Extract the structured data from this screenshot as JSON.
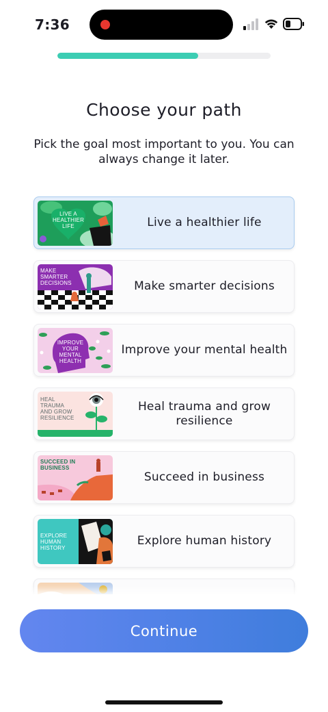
{
  "status_bar": {
    "time": "7:36",
    "icons": [
      "recording-dot-icon",
      "signal-icon",
      "wifi-icon",
      "battery-icon"
    ]
  },
  "progress": {
    "fraction": 0.66,
    "color": "#3ccdb3"
  },
  "header": {
    "title": "Choose your path",
    "subtitle": "Pick the goal most important to you. You can always change it later."
  },
  "options": [
    {
      "label": "Live a healthier life",
      "thumb_text": [
        "LIVE A",
        "HEALTHIER",
        "LIFE"
      ],
      "selected": true
    },
    {
      "label": "Make smarter decisions",
      "thumb_text": [
        "MAKE",
        "SMARTER",
        "DECISIONS"
      ],
      "selected": false
    },
    {
      "label": "Improve your mental health",
      "thumb_text": [
        "IMPROVE",
        "YOUR",
        "MENTAL",
        "HEALTH"
      ],
      "selected": false
    },
    {
      "label": "Heal trauma and grow resilience",
      "thumb_text": [
        "HEAL",
        "TRAUMA",
        "AND GROW",
        "RESILIENCE"
      ],
      "selected": false
    },
    {
      "label": "Succeed in business",
      "thumb_text": [
        "SUCCEED IN",
        "BUSINESS"
      ],
      "selected": false
    },
    {
      "label": "Explore human history",
      "thumb_text": [
        "EXPLORE",
        "HUMAN",
        "HISTORY"
      ],
      "selected": false
    },
    {
      "label": "",
      "thumb_text": [],
      "selected": false
    }
  ],
  "colors": {
    "accent": "#4f81e6",
    "selected_bg": "#e3eefb",
    "selected_border": "#a8cbef"
  },
  "footer": {
    "continue_label": "Continue"
  }
}
